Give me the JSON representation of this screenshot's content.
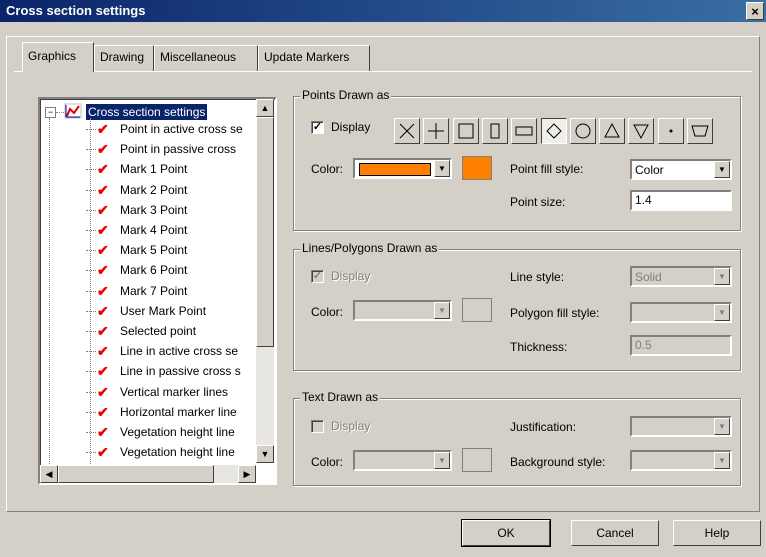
{
  "window": {
    "title": "Cross section settings",
    "close_glyph": "×"
  },
  "tabs": [
    "Graphics",
    "Drawing",
    "Miscellaneous",
    "Update Markers"
  ],
  "tree": {
    "root": "Cross section settings",
    "items": [
      "Point in active cross se",
      "Point in passive cross",
      "Mark 1 Point",
      "Mark 2 Point",
      "Mark 3 Point",
      "Mark 4 Point",
      "Mark 5 Point",
      "Mark 6 Point",
      "Mark 7 Point",
      "User Mark Point",
      "Selected point",
      "Line in active cross se",
      "Line in passive cross s",
      "Vertical marker lines",
      "Horizontal marker line",
      "Vegetation height line",
      "Vegetation height line"
    ],
    "check_glyph": "✔",
    "collapse_glyph": "−"
  },
  "points": {
    "title": "Points Drawn as",
    "display_label": "Display",
    "display_checked": true,
    "color_label": "Color:",
    "color": "#ff8000",
    "fill_style_label": "Point fill style:",
    "fill_style_value": "Color",
    "size_label": "Point size:",
    "size_value": "1.4",
    "shapes": [
      "x-mark-icon",
      "plus-icon",
      "square-icon",
      "tall-rect-icon",
      "wide-rect-icon",
      "diamond-icon",
      "circle-icon",
      "triangle-up-icon",
      "triangle-down-icon",
      "dot-icon",
      "trapezoid-icon"
    ],
    "selected_shape": "diamond-icon"
  },
  "lines": {
    "title": "Lines/Polygons Drawn as",
    "display_label": "Display",
    "color_label": "Color:",
    "line_style_label": "Line style:",
    "line_style_value": "Solid",
    "polygon_fill_label": "Polygon fill style:",
    "thickness_label": "Thickness:",
    "thickness_value": "0.5"
  },
  "text": {
    "title": "Text Drawn as",
    "display_label": "Display",
    "color_label": "Color:",
    "justification_label": "Justification:",
    "background_label": "Background style:"
  },
  "buttons": {
    "ok": "OK",
    "cancel": "Cancel",
    "help": "Help"
  }
}
